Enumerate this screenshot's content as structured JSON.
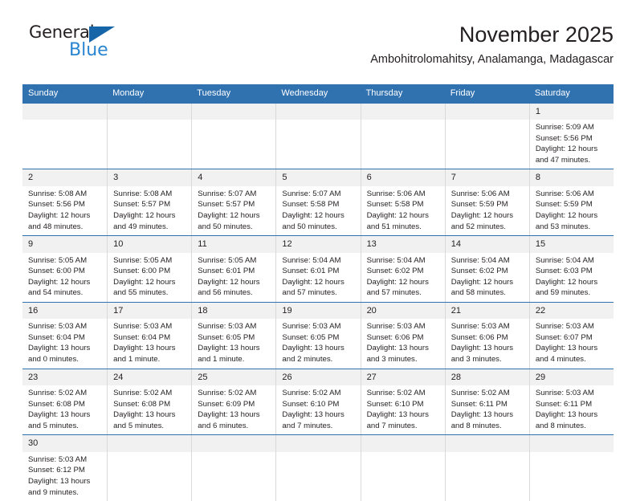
{
  "brand": {
    "line1": "General",
    "line2": "Blue",
    "flag_icon": "blue-triangle-flag"
  },
  "header": {
    "title": "November 2025",
    "subtitle": "Ambohitrolomahitsy, Analamanga, Madagascar"
  },
  "colors": {
    "header_blue": "#3071b0",
    "brand_blue": "#2a85d0",
    "flag_blue": "#1565a8",
    "day_band": "#f1f1f1",
    "text": "#231f20",
    "cell_border": "#d9d9d9"
  },
  "weekdays": [
    "Sunday",
    "Monday",
    "Tuesday",
    "Wednesday",
    "Thursday",
    "Friday",
    "Saturday"
  ],
  "labels": {
    "sunrise": "Sunrise:",
    "sunset": "Sunset:",
    "daylight": "Daylight:"
  },
  "weeks": [
    [
      {
        "day": "",
        "empty": true
      },
      {
        "day": "",
        "empty": true
      },
      {
        "day": "",
        "empty": true
      },
      {
        "day": "",
        "empty": true
      },
      {
        "day": "",
        "empty": true
      },
      {
        "day": "",
        "empty": true
      },
      {
        "day": "1",
        "sunrise": "Sunrise: 5:09 AM",
        "sunset": "Sunset: 5:56 PM",
        "daylight": "Daylight: 12 hours and 47 minutes."
      }
    ],
    [
      {
        "day": "2",
        "sunrise": "Sunrise: 5:08 AM",
        "sunset": "Sunset: 5:56 PM",
        "daylight": "Daylight: 12 hours and 48 minutes."
      },
      {
        "day": "3",
        "sunrise": "Sunrise: 5:08 AM",
        "sunset": "Sunset: 5:57 PM",
        "daylight": "Daylight: 12 hours and 49 minutes."
      },
      {
        "day": "4",
        "sunrise": "Sunrise: 5:07 AM",
        "sunset": "Sunset: 5:57 PM",
        "daylight": "Daylight: 12 hours and 50 minutes."
      },
      {
        "day": "5",
        "sunrise": "Sunrise: 5:07 AM",
        "sunset": "Sunset: 5:58 PM",
        "daylight": "Daylight: 12 hours and 50 minutes."
      },
      {
        "day": "6",
        "sunrise": "Sunrise: 5:06 AM",
        "sunset": "Sunset: 5:58 PM",
        "daylight": "Daylight: 12 hours and 51 minutes."
      },
      {
        "day": "7",
        "sunrise": "Sunrise: 5:06 AM",
        "sunset": "Sunset: 5:59 PM",
        "daylight": "Daylight: 12 hours and 52 minutes."
      },
      {
        "day": "8",
        "sunrise": "Sunrise: 5:06 AM",
        "sunset": "Sunset: 5:59 PM",
        "daylight": "Daylight: 12 hours and 53 minutes."
      }
    ],
    [
      {
        "day": "9",
        "sunrise": "Sunrise: 5:05 AM",
        "sunset": "Sunset: 6:00 PM",
        "daylight": "Daylight: 12 hours and 54 minutes."
      },
      {
        "day": "10",
        "sunrise": "Sunrise: 5:05 AM",
        "sunset": "Sunset: 6:00 PM",
        "daylight": "Daylight: 12 hours and 55 minutes."
      },
      {
        "day": "11",
        "sunrise": "Sunrise: 5:05 AM",
        "sunset": "Sunset: 6:01 PM",
        "daylight": "Daylight: 12 hours and 56 minutes."
      },
      {
        "day": "12",
        "sunrise": "Sunrise: 5:04 AM",
        "sunset": "Sunset: 6:01 PM",
        "daylight": "Daylight: 12 hours and 57 minutes."
      },
      {
        "day": "13",
        "sunrise": "Sunrise: 5:04 AM",
        "sunset": "Sunset: 6:02 PM",
        "daylight": "Daylight: 12 hours and 57 minutes."
      },
      {
        "day": "14",
        "sunrise": "Sunrise: 5:04 AM",
        "sunset": "Sunset: 6:02 PM",
        "daylight": "Daylight: 12 hours and 58 minutes."
      },
      {
        "day": "15",
        "sunrise": "Sunrise: 5:04 AM",
        "sunset": "Sunset: 6:03 PM",
        "daylight": "Daylight: 12 hours and 59 minutes."
      }
    ],
    [
      {
        "day": "16",
        "sunrise": "Sunrise: 5:03 AM",
        "sunset": "Sunset: 6:04 PM",
        "daylight": "Daylight: 13 hours and 0 minutes."
      },
      {
        "day": "17",
        "sunrise": "Sunrise: 5:03 AM",
        "sunset": "Sunset: 6:04 PM",
        "daylight": "Daylight: 13 hours and 1 minute."
      },
      {
        "day": "18",
        "sunrise": "Sunrise: 5:03 AM",
        "sunset": "Sunset: 6:05 PM",
        "daylight": "Daylight: 13 hours and 1 minute."
      },
      {
        "day": "19",
        "sunrise": "Sunrise: 5:03 AM",
        "sunset": "Sunset: 6:05 PM",
        "daylight": "Daylight: 13 hours and 2 minutes."
      },
      {
        "day": "20",
        "sunrise": "Sunrise: 5:03 AM",
        "sunset": "Sunset: 6:06 PM",
        "daylight": "Daylight: 13 hours and 3 minutes."
      },
      {
        "day": "21",
        "sunrise": "Sunrise: 5:03 AM",
        "sunset": "Sunset: 6:06 PM",
        "daylight": "Daylight: 13 hours and 3 minutes."
      },
      {
        "day": "22",
        "sunrise": "Sunrise: 5:03 AM",
        "sunset": "Sunset: 6:07 PM",
        "daylight": "Daylight: 13 hours and 4 minutes."
      }
    ],
    [
      {
        "day": "23",
        "sunrise": "Sunrise: 5:02 AM",
        "sunset": "Sunset: 6:08 PM",
        "daylight": "Daylight: 13 hours and 5 minutes."
      },
      {
        "day": "24",
        "sunrise": "Sunrise: 5:02 AM",
        "sunset": "Sunset: 6:08 PM",
        "daylight": "Daylight: 13 hours and 5 minutes."
      },
      {
        "day": "25",
        "sunrise": "Sunrise: 5:02 AM",
        "sunset": "Sunset: 6:09 PM",
        "daylight": "Daylight: 13 hours and 6 minutes."
      },
      {
        "day": "26",
        "sunrise": "Sunrise: 5:02 AM",
        "sunset": "Sunset: 6:10 PM",
        "daylight": "Daylight: 13 hours and 7 minutes."
      },
      {
        "day": "27",
        "sunrise": "Sunrise: 5:02 AM",
        "sunset": "Sunset: 6:10 PM",
        "daylight": "Daylight: 13 hours and 7 minutes."
      },
      {
        "day": "28",
        "sunrise": "Sunrise: 5:02 AM",
        "sunset": "Sunset: 6:11 PM",
        "daylight": "Daylight: 13 hours and 8 minutes."
      },
      {
        "day": "29",
        "sunrise": "Sunrise: 5:03 AM",
        "sunset": "Sunset: 6:11 PM",
        "daylight": "Daylight: 13 hours and 8 minutes."
      }
    ],
    [
      {
        "day": "30",
        "sunrise": "Sunrise: 5:03 AM",
        "sunset": "Sunset: 6:12 PM",
        "daylight": "Daylight: 13 hours and 9 minutes."
      },
      {
        "day": "",
        "empty": true
      },
      {
        "day": "",
        "empty": true
      },
      {
        "day": "",
        "empty": true
      },
      {
        "day": "",
        "empty": true
      },
      {
        "day": "",
        "empty": true
      },
      {
        "day": "",
        "empty": true
      }
    ]
  ]
}
